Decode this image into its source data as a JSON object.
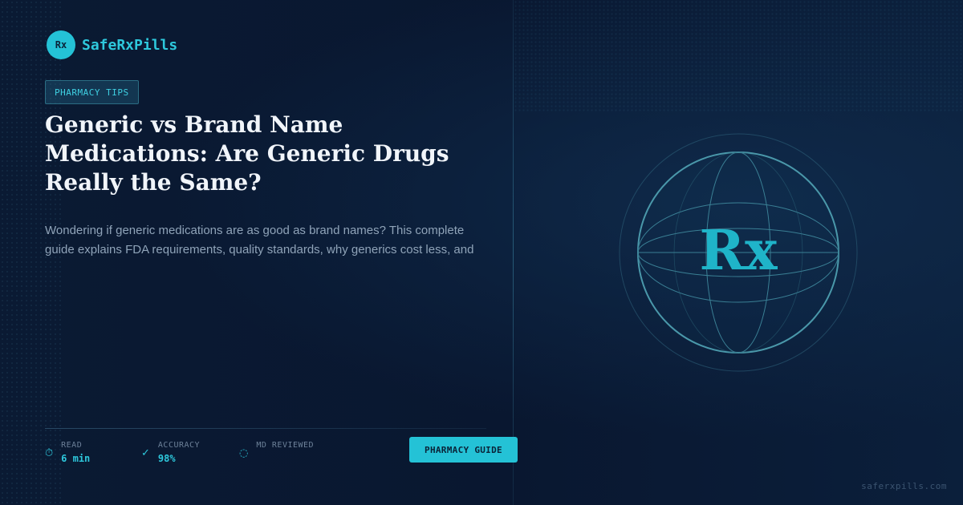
{
  "brand": {
    "logo_text": "Rx",
    "name": "SafeRxPills"
  },
  "tag": "PHARMACY TIPS",
  "article": {
    "title": "Generic vs Brand Name Medications: Are Generic Drugs Really the Same?",
    "description": "Wondering if generic medications are as good as brand names? This complete guide explains FDA requirements, quality standards, why generics cost less, and"
  },
  "stats": [
    {
      "icon": "clock-icon",
      "glyph": "⏱",
      "label": "READ",
      "value": "6 min"
    },
    {
      "icon": "check-icon",
      "glyph": "✓",
      "label": "ACCURACY",
      "value": "98%"
    },
    {
      "icon": "loading-icon",
      "glyph": "◌",
      "label": "MD REVIEWED",
      "value": ""
    }
  ],
  "cta": {
    "label": "PHARMACY GUIDE"
  },
  "hero": {
    "symbol": "Rx"
  },
  "footer": {
    "domain": "saferxpills.com"
  },
  "colors": {
    "accent": "#24c2d6",
    "background": "#0a1830",
    "title": "#f1f5fa",
    "muted": "#8fa3b8"
  }
}
